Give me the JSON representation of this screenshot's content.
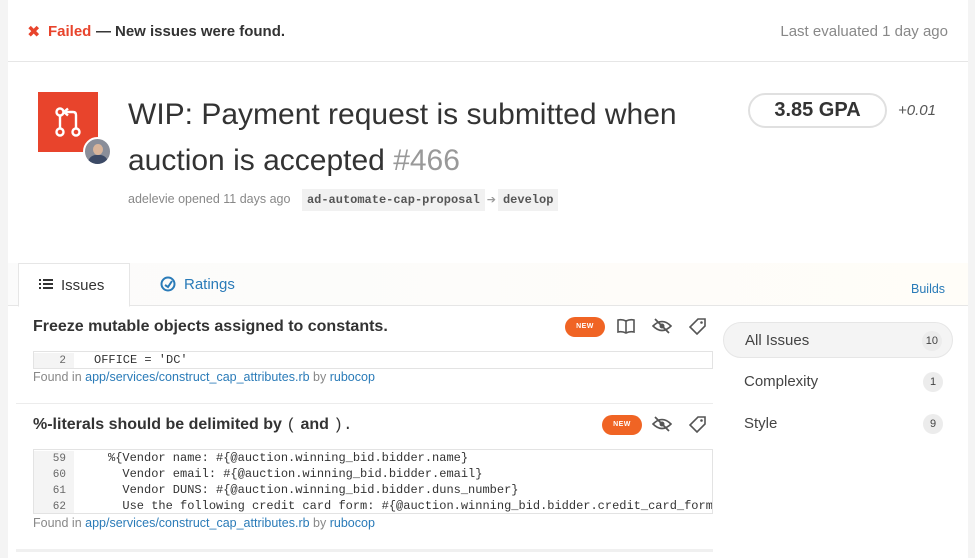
{
  "status": {
    "x_glyph": "✖",
    "failed_label": "Failed",
    "separator": "—",
    "message": "New issues were found.",
    "evaluated": "Last evaluated 1 day ago"
  },
  "pr": {
    "title": "WIP: Payment request is submitted when auction is accepted",
    "number": "#466",
    "author": "adelevie",
    "opened_text": "opened",
    "age": "11 days ago",
    "source_branch": "ad-automate-cap-proposal",
    "target_branch": "develop"
  },
  "gpa": {
    "value": "3.85 GPA",
    "delta": "+0.01"
  },
  "tabs": [
    {
      "label": "Issues",
      "icon": "list-icon",
      "active": true
    },
    {
      "label": "Ratings",
      "icon": "gauge-icon",
      "active": false
    }
  ],
  "builds_link": "Builds",
  "issues": [
    {
      "title": "Freeze mutable objects assigned to constants.",
      "badge": "NEW",
      "code": [
        {
          "ln": "2",
          "text": "OFFICE = 'DC'"
        }
      ],
      "found_in_label": "Found in",
      "path": "app/services/construct_cap_attributes.rb",
      "by_label": "by",
      "engine": "rubocop"
    },
    {
      "title_prefix": "%-literals should be delimited by",
      "title_open": "(",
      "title_and": "and",
      "title_close": ").",
      "badge": "NEW",
      "code": [
        {
          "ln": "59",
          "text": "%{Vendor name: #{@auction.winning_bid.bidder.name}"
        },
        {
          "ln": "60",
          "text": "  Vendor email: #{@auction.winning_bid.bidder.email}"
        },
        {
          "ln": "61",
          "text": "  Vendor DUNS: #{@auction.winning_bid.bidder.duns_number}"
        },
        {
          "ln": "62",
          "text": "  Use the following credit card form: #{@auction.winning_bid.bidder.credit_card_form_u"
        }
      ],
      "found_in_label": "Found in",
      "path": "app/services/construct_cap_attributes.rb",
      "by_label": "by",
      "engine": "rubocop"
    }
  ],
  "sidebar": [
    {
      "label": "All Issues",
      "count": "10",
      "active": true
    },
    {
      "label": "Complexity",
      "count": "1",
      "active": false
    },
    {
      "label": "Style",
      "count": "9",
      "active": false
    }
  ],
  "colors": {
    "danger": "#e8442c",
    "link": "#2a7bb8",
    "badge": "#f06424"
  }
}
